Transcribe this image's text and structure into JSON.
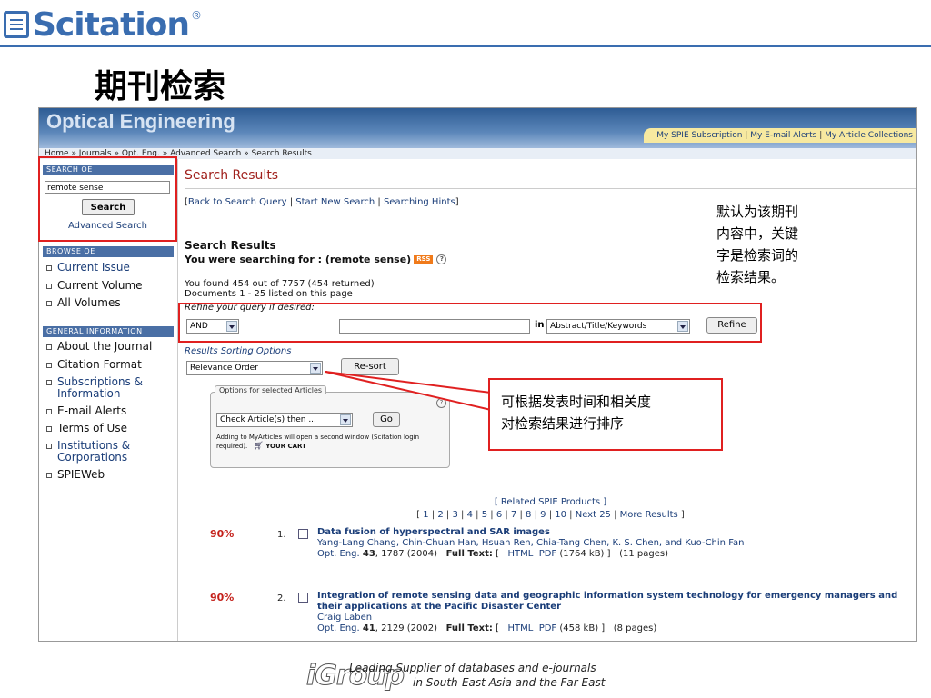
{
  "slide": {
    "logo_text": "Scitation",
    "logo_mark": "®",
    "title": "期刊检索"
  },
  "site": {
    "banner_title": "Optical Engineering",
    "topnav": [
      "My SPIE Subscription",
      "My E-mail Alerts",
      "My Article Collections"
    ],
    "breadcrumb": "Home » Journals » Opt. Eng. » Advanced Search » Search Results"
  },
  "sidebar": {
    "search_head": "SEARCH OE",
    "search_value": "remote sense",
    "search_button": "Search",
    "advanced_link": "Advanced Search",
    "browse_head": "BROWSE OE",
    "browse_items": [
      "Current Issue",
      "Current Volume",
      "All Volumes"
    ],
    "info_head": "GENERAL INFORMATION",
    "info_items": [
      "About the Journal",
      "Citation Format",
      "Subscriptions & Information",
      "E-mail Alerts",
      "Terms of Use",
      "Institutions & Corporations",
      "SPIEWeb"
    ]
  },
  "main": {
    "heading": "Search Results",
    "links": [
      "Back to Search Query",
      "Start New Search",
      "Searching Hints"
    ],
    "subheading": "Search Results",
    "searching_for": "You were searching for : (remote sense)",
    "rss": "RSS",
    "found_line1": "You found 454 out of 7757 (454 returned)",
    "found_line2": "Documents 1 - 25 listed on this page",
    "refine_label": "Refine your query if desired:",
    "refine_operator": "AND",
    "refine_in": "in",
    "refine_field": "Abstract/Title/Keywords",
    "refine_button": "Refine",
    "sort_label": "Results Sorting Options",
    "sort_value": "Relevance Order",
    "resort_button": "Re-sort",
    "options_tab": "Options for selected Articles",
    "options_select": "Check Article(s) then ...",
    "go_button": "Go",
    "options_note": "Adding to MyArticles will open a second window (Scitation login required).",
    "cart_label": "YOUR CART",
    "related": "[ Related SPIE Products ]",
    "pages": [
      "1",
      "2",
      "3",
      "4",
      "5",
      "6",
      "7",
      "8",
      "9",
      "10",
      "Next 25",
      "More Results"
    ],
    "articles": [
      {
        "score": "90%",
        "num": "1.",
        "title": "Data fusion of hyperspectral and SAR images",
        "authors": "Yang-Lang Chang, Chin-Chuan Han, Hsuan Ren, Chia-Tang Chen, K. S. Chen, and Kuo-Chin Fan",
        "journal": "Opt. Eng.",
        "volume": "43",
        "cite": ", 1787 (2004)",
        "fulltext": "Full Text:",
        "html": "HTML",
        "pdf": "PDF",
        "size": "(1764 kB)",
        "pages": "(11 pages)"
      },
      {
        "score": "90%",
        "num": "2.",
        "title": "Integration of remote sensing data and geographic information system technology for emergency managers and their applications at the Pacific Disaster Center",
        "authors": "Craig Laben",
        "journal": "Opt. Eng.",
        "volume": "41",
        "cite": ", 2129 (2002)",
        "fulltext": "Full Text:",
        "html": "HTML",
        "pdf": "PDF",
        "size": "(458 kB)",
        "pages": "(8 pages)"
      }
    ]
  },
  "annotations": {
    "note_default": [
      "默认为该期刊",
      "内容中，关键",
      "字是检索词的",
      "检索结果。"
    ],
    "note_sort": [
      "可根据发表时间和相关度",
      "对检索结果进行排序"
    ],
    "red": "#e02020"
  },
  "footer": {
    "brand": "iGroup",
    "line1": "Leading Supplier of databases and e-journals",
    "line2": "in South-East Asia and the Far East"
  }
}
